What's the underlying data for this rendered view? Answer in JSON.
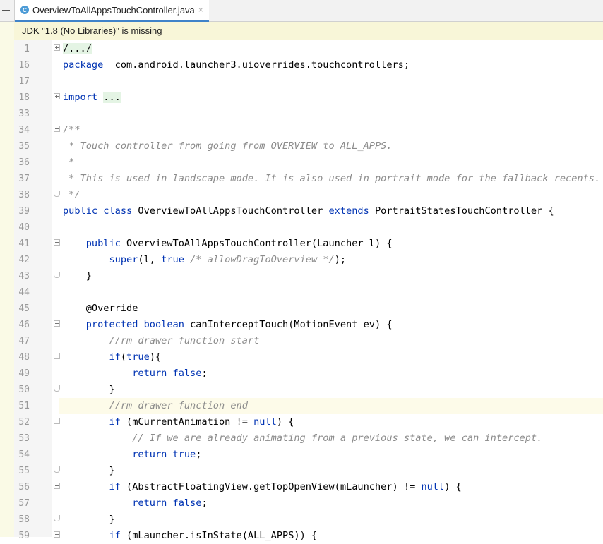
{
  "tab": {
    "title": "OverviewToAllAppsTouchController.java",
    "icon_letter": "C",
    "close": "×"
  },
  "notice": {
    "text": "JDK \"1.8 (No Libraries)\" is missing"
  },
  "lines": [
    {
      "n": "1",
      "fold": "plus",
      "segs": [
        [
          "hl",
          "/.../"
        ]
      ]
    },
    {
      "n": "16",
      "fold": "",
      "segs": [
        [
          "kw",
          "package"
        ],
        [
          "",
          "  com.android.launcher3.uioverrides.touchcontrollers;"
        ]
      ]
    },
    {
      "n": "17",
      "fold": "",
      "segs": []
    },
    {
      "n": "18",
      "fold": "plus",
      "segs": [
        [
          "kw",
          "import"
        ],
        [
          "",
          " "
        ],
        [
          "hl",
          "..."
        ]
      ]
    },
    {
      "n": "33",
      "fold": "",
      "segs": []
    },
    {
      "n": "34",
      "fold": "minus",
      "segs": [
        [
          "cm",
          "/**"
        ]
      ]
    },
    {
      "n": "35",
      "fold": "",
      "segs": [
        [
          "cm",
          " * Touch controller from going from OVERVIEW to ALL_APPS."
        ]
      ]
    },
    {
      "n": "36",
      "fold": "",
      "segs": [
        [
          "cm",
          " *"
        ]
      ]
    },
    {
      "n": "37",
      "fold": "",
      "segs": [
        [
          "cm",
          " * This is used in landscape mode. It is also used in portrait mode for the fallback recents."
        ]
      ]
    },
    {
      "n": "38",
      "fold": "end",
      "segs": [
        [
          "cm",
          " */"
        ]
      ]
    },
    {
      "n": "39",
      "fold": "",
      "segs": [
        [
          "kw",
          "public class"
        ],
        [
          "",
          " OverviewToAllAppsTouchController "
        ],
        [
          "kw",
          "extends"
        ],
        [
          "",
          " PortraitStatesTouchController {"
        ]
      ]
    },
    {
      "n": "40",
      "fold": "",
      "segs": []
    },
    {
      "n": "41",
      "fold": "minus",
      "segs": [
        [
          "",
          "    "
        ],
        [
          "kw",
          "public"
        ],
        [
          "",
          " OverviewToAllAppsTouchController(Launcher l) {"
        ]
      ]
    },
    {
      "n": "42",
      "fold": "",
      "segs": [
        [
          "",
          "        "
        ],
        [
          "kw",
          "super"
        ],
        [
          "",
          "(l, "
        ],
        [
          "kw",
          "true"
        ],
        [
          "",
          " "
        ],
        [
          "cm",
          "/* allowDragToOverview */"
        ],
        [
          "",
          ");"
        ]
      ]
    },
    {
      "n": "43",
      "fold": "end",
      "segs": [
        [
          "",
          "    }"
        ]
      ]
    },
    {
      "n": "44",
      "fold": "",
      "segs": []
    },
    {
      "n": "45",
      "fold": "",
      "segs": [
        [
          "",
          "    @Override"
        ]
      ]
    },
    {
      "n": "46",
      "fold": "minus",
      "segs": [
        [
          "",
          "    "
        ],
        [
          "kw",
          "protected boolean"
        ],
        [
          "",
          " canInterceptTouch(MotionEvent ev) {"
        ]
      ]
    },
    {
      "n": "47",
      "fold": "",
      "segs": [
        [
          "",
          "        "
        ],
        [
          "cm",
          "//rm drawer function start"
        ]
      ]
    },
    {
      "n": "48",
      "fold": "minus",
      "segs": [
        [
          "",
          "        "
        ],
        [
          "kw",
          "if"
        ],
        [
          "",
          "("
        ],
        [
          "kw",
          "true"
        ],
        [
          "",
          "){"
        ]
      ]
    },
    {
      "n": "49",
      "fold": "",
      "segs": [
        [
          "",
          "            "
        ],
        [
          "kw",
          "return false"
        ],
        [
          "",
          ";"
        ]
      ]
    },
    {
      "n": "50",
      "fold": "end",
      "segs": [
        [
          "",
          "        }"
        ]
      ]
    },
    {
      "n": "51",
      "fold": "",
      "segs": [
        [
          "",
          "        "
        ],
        [
          "cm",
          "//rm drawer function end"
        ]
      ],
      "current": true
    },
    {
      "n": "52",
      "fold": "minus",
      "segs": [
        [
          "",
          "        "
        ],
        [
          "kw",
          "if"
        ],
        [
          "",
          " (mCurrentAnimation != "
        ],
        [
          "kw",
          "null"
        ],
        [
          "",
          ") {"
        ]
      ]
    },
    {
      "n": "53",
      "fold": "",
      "segs": [
        [
          "",
          "            "
        ],
        [
          "cm",
          "// If we are already animating from a previous state, we can intercept."
        ]
      ]
    },
    {
      "n": "54",
      "fold": "",
      "segs": [
        [
          "",
          "            "
        ],
        [
          "kw",
          "return true"
        ],
        [
          "",
          ";"
        ]
      ]
    },
    {
      "n": "55",
      "fold": "end",
      "segs": [
        [
          "",
          "        }"
        ]
      ]
    },
    {
      "n": "56",
      "fold": "minus",
      "segs": [
        [
          "",
          "        "
        ],
        [
          "kw",
          "if"
        ],
        [
          "",
          " (AbstractFloatingView.getTopOpenView(mLauncher) != "
        ],
        [
          "kw",
          "null"
        ],
        [
          "",
          ") {"
        ]
      ]
    },
    {
      "n": "57",
      "fold": "",
      "segs": [
        [
          "",
          "            "
        ],
        [
          "kw",
          "return false"
        ],
        [
          "",
          ";"
        ]
      ]
    },
    {
      "n": "58",
      "fold": "end",
      "segs": [
        [
          "",
          "        }"
        ]
      ]
    },
    {
      "n": "59",
      "fold": "minus",
      "segs": [
        [
          "",
          "        "
        ],
        [
          "kw",
          "if"
        ],
        [
          "",
          " (mLauncher.isInState(ALL_APPS)) {"
        ]
      ]
    }
  ]
}
